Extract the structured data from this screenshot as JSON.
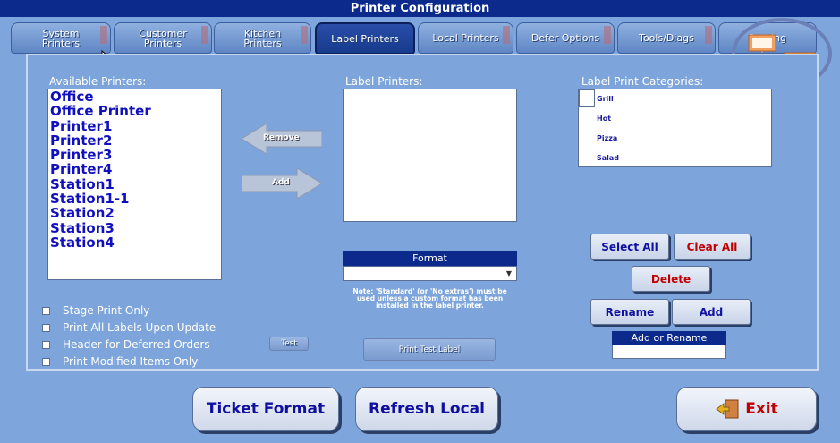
{
  "window": {
    "title": "Printer Configuration"
  },
  "tabs": [
    {
      "label": "System\nPrinters"
    },
    {
      "label": "Customer\nPrinters"
    },
    {
      "label": "Kitchen\nPrinters"
    },
    {
      "label": "Label Printers"
    },
    {
      "label": "Local Printers"
    },
    {
      "label": "Defer Options"
    },
    {
      "label": "Tools/Diags"
    },
    {
      "label": "Routing"
    }
  ],
  "available": {
    "label": "Available Printers:",
    "items": [
      "Office",
      "Office Printer",
      "Printer1",
      "Printer2",
      "Printer3",
      "Printer4",
      "Station1",
      "Station1-1",
      "Station2",
      "Station3",
      "Station4"
    ]
  },
  "arrows": {
    "remove": "Remove",
    "add": "Add"
  },
  "label_printers": {
    "label": "Label Printers:"
  },
  "format": {
    "header": "Format",
    "value": "",
    "note": "Note: 'Standard' (or 'No extras') must be used unless a custom format has been installed in the label printer."
  },
  "categories": {
    "label": "Label Print Categories:",
    "items": [
      "Grill",
      "Hot",
      "Pizza",
      "Salad"
    ]
  },
  "buttons": {
    "select_all": "Select All",
    "clear_all": "Clear All",
    "delete": "Delete",
    "rename": "Rename",
    "add": "Add",
    "test": "Test",
    "print_test_label": "Print Test Label",
    "ticket_format": "Ticket Format",
    "refresh_local": "Refresh Local",
    "exit": "Exit"
  },
  "add_or_rename": {
    "header": "Add or Rename",
    "value": ""
  },
  "options": [
    {
      "label": "Stage Print Only",
      "checked": false
    },
    {
      "label": "Print All Labels Upon Update",
      "checked": false
    },
    {
      "label": "Header for Deferred Orders",
      "checked": false
    },
    {
      "label": "Print Modified Items Only",
      "checked": false
    }
  ],
  "colors": {
    "title_bar": "#0c2a8c",
    "background": "#7fa6dc",
    "list_text": "#1010c0",
    "danger": "#c00000"
  }
}
